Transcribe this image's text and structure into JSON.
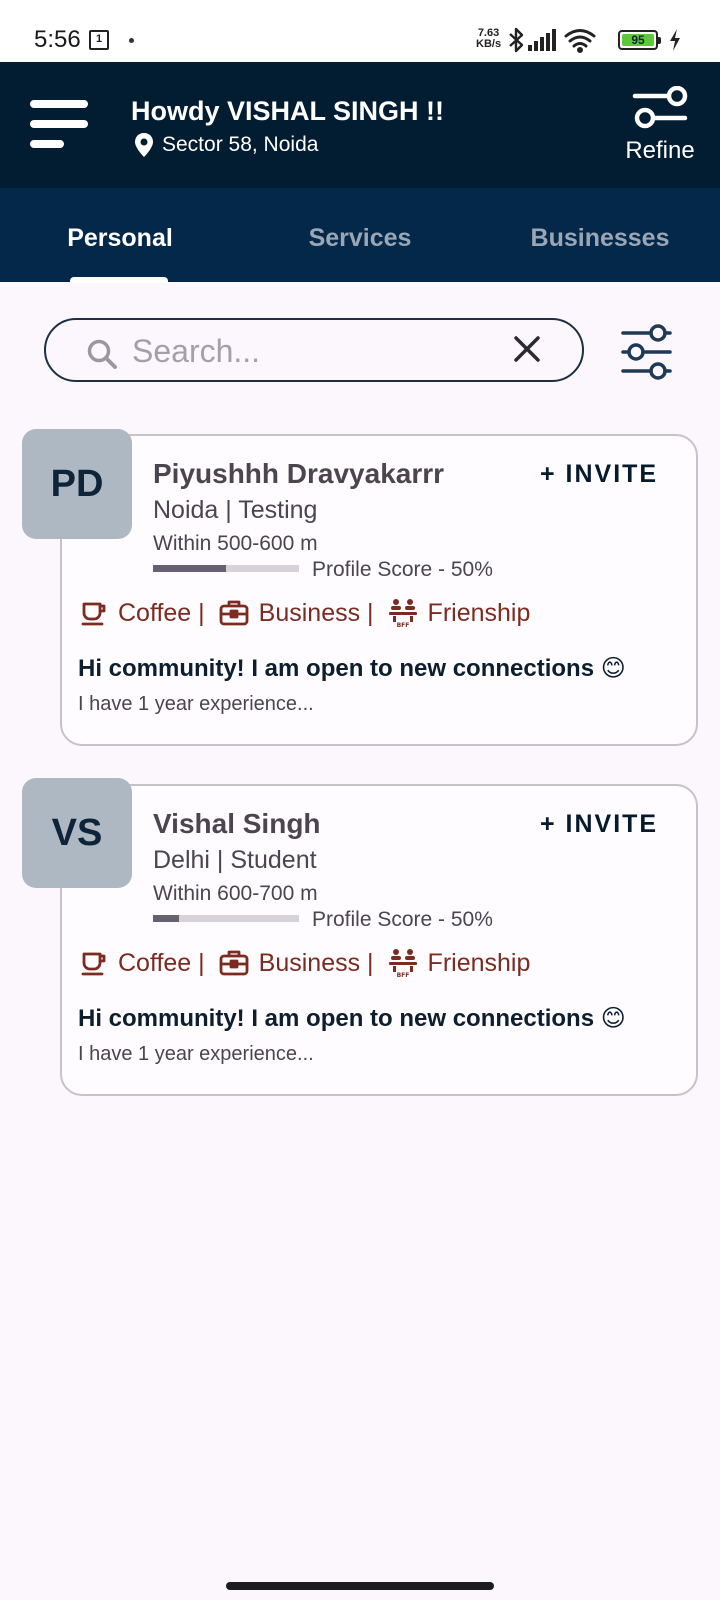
{
  "status_bar": {
    "time": "5:56",
    "sim": "1",
    "net_speed_value": "7.63",
    "net_speed_unit": "KB/s",
    "battery": "95"
  },
  "header": {
    "greeting": "Howdy VISHAL SINGH !!",
    "location": "Sector 58, Noida",
    "refine_label": "Refine"
  },
  "tabs": [
    {
      "label": "Personal",
      "active": true
    },
    {
      "label": "Services",
      "active": false
    },
    {
      "label": "Businesses",
      "active": false
    }
  ],
  "search": {
    "placeholder": "Search..."
  },
  "cards": [
    {
      "initials": "PD",
      "name": "Piyushhh Dravyakarrr",
      "invite": "+ INVITE",
      "meta": "Noida | Testing",
      "distance": "Within 500-600 m",
      "profile_score_fraction": 0.5,
      "profile_score_label": "Profile Score - 50%",
      "tags": [
        "Coffee |",
        "Business |",
        "Frienship"
      ],
      "headline": "Hi community! I am open to new connections 😊",
      "description": "I have 1 year experience..."
    },
    {
      "initials": "VS",
      "name": "Vishal Singh",
      "invite": "+ INVITE",
      "meta": "Delhi | Student",
      "distance": "Within 600-700 m",
      "profile_score_fraction": 0.18,
      "profile_score_label": "Profile Score - 50%",
      "tags": [
        "Coffee |",
        "Business |",
        "Frienship"
      ],
      "headline": "Hi community! I am open to new connections 😊",
      "description": "I have 1 year experience..."
    }
  ],
  "colors": {
    "header_bg": "#021c31",
    "tabs_bg": "#04284a",
    "tag_color": "#7b2b1f",
    "avatar_bg": "#adb8c3",
    "page_bg": "#fcf7fc"
  }
}
